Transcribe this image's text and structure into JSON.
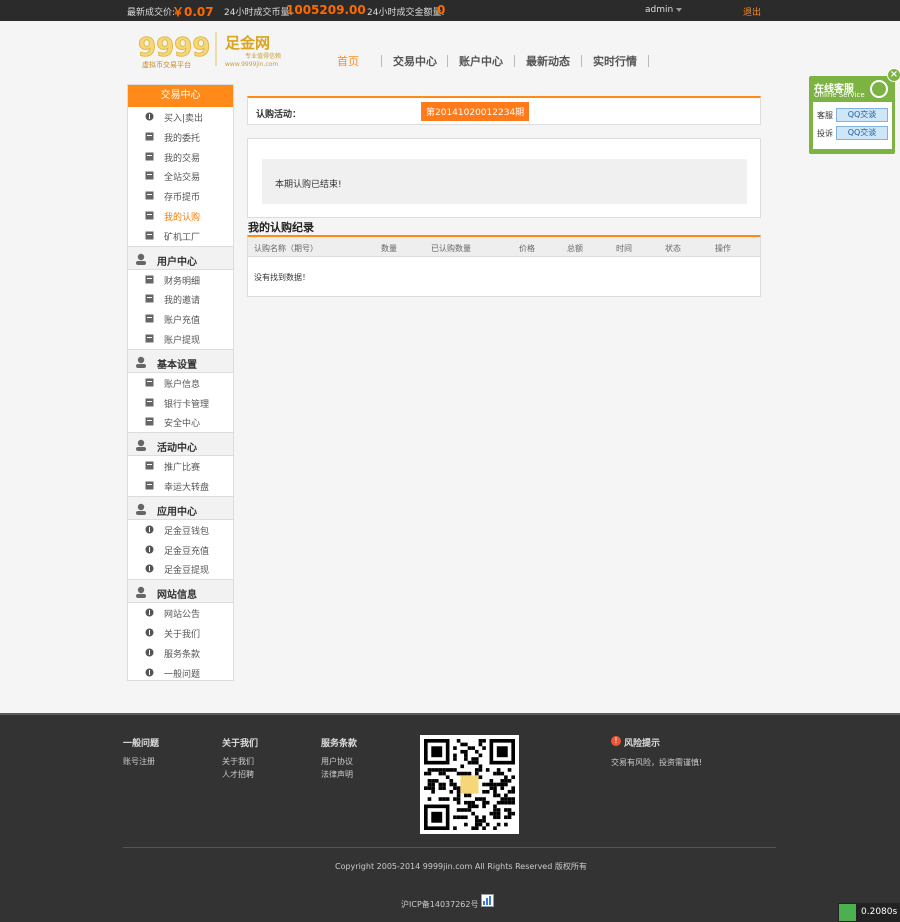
{
  "topbar": {
    "last_price_label": "最新成交价:",
    "last_price_value": "￥0.07",
    "volume_label": "24小时成交币量:",
    "volume_value": "1005209.00",
    "amount_label": "24小时成交金额量:",
    "amount_value": "0",
    "user": "admin",
    "logout": "退出"
  },
  "logo": {
    "name": "足金网",
    "tagline": "专业值得信赖",
    "subtitle": "虚拟币交易平台",
    "url": "www.9999jin.com"
  },
  "nav": [
    "首页",
    "交易中心",
    "账户中心",
    "最新动态",
    "实时行情"
  ],
  "sidebar": {
    "header": "交易中心",
    "trade_items": [
      "买入|卖出",
      "我的委托",
      "我的交易",
      "全站交易",
      "存币提币",
      "我的认购",
      "矿机工厂"
    ],
    "active_item": "我的认购",
    "groups": [
      {
        "title": "用户中心",
        "items": [
          "财务明细",
          "我的邀请",
          "账户充值",
          "账户提现"
        ]
      },
      {
        "title": "基本设置",
        "items": [
          "账户信息",
          "银行卡管理",
          "安全中心"
        ]
      },
      {
        "title": "活动中心",
        "items": [
          "推广比赛",
          "幸运大转盘"
        ]
      },
      {
        "title": "应用中心",
        "items": [
          "足金豆钱包",
          "足金豆充值",
          "足金豆提现"
        ]
      },
      {
        "title": "网站信息",
        "items": [
          "网站公告",
          "关于我们",
          "服务条款",
          "一般问题"
        ]
      }
    ]
  },
  "subscription": {
    "label": "认购活动：",
    "period": "第20141020012234期",
    "status_text": "本期认购已结束!"
  },
  "records": {
    "title": "我的认购纪录",
    "columns": [
      "认购名称（期号）",
      "数量",
      "已认购数量",
      "价格",
      "总额",
      "时间",
      "状态",
      "操作"
    ],
    "empty": "没有找到数据！"
  },
  "service": {
    "title": "在线客服",
    "subtitle": "Online Service",
    "rows": [
      {
        "label": "客服",
        "button": "QQ交谈"
      },
      {
        "label": "投诉",
        "button": "QQ交谈"
      }
    ]
  },
  "footer": {
    "cols": [
      {
        "title": "一般问题",
        "links": [
          "账号注册"
        ]
      },
      {
        "title": "关于我们",
        "links": [
          "关于我们",
          "人才招聘"
        ]
      },
      {
        "title": "服务条款",
        "links": [
          "用户协议",
          "法律声明"
        ]
      }
    ],
    "risk_title": "风险提示",
    "risk_text": "交易有风险，投资需谨慎!",
    "copyright": "Copyright 2005-2014 9999jin.com All Rights Reserved 版权所有",
    "icp": "沪ICP备14037262号",
    "perf": "0.2080s"
  },
  "colors": {
    "accent": "#ff8a1a",
    "dark": "#2b2b2b",
    "green": "#7cb342"
  }
}
